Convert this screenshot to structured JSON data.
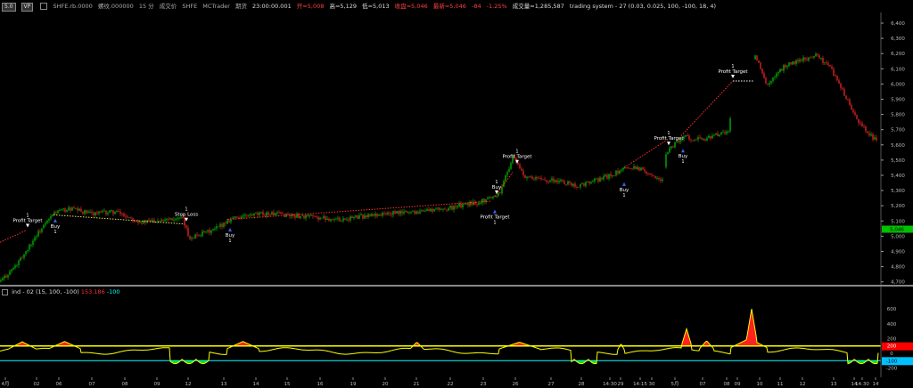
{
  "infobar": {
    "btn1": "5.0",
    "btn2": "VP",
    "symbol": "SHFE.rb.0000",
    "name": "螺纹.000000",
    "interval": "15 分",
    "label_chengjiao": "成交价",
    "exchange": "SHFE",
    "platform": "MCTrader",
    "label_futures": "期货",
    "time": "23:00:00.001",
    "open": "开=5,008",
    "high": "高=5,129",
    "low": "低=5,013",
    "close": "收盘=5,046",
    "close_label": "最新=5,046",
    "change": "-84",
    "change_pct": "-1.25%",
    "volume": "成交量=1,285,587",
    "strategy": "trading system - 27 (0.03, 0.025, 100, -100, 18, 4)"
  },
  "price_axis": {
    "ticks": [
      "6,400",
      "6,300",
      "6,200",
      "6,100",
      "6,000",
      "5,900",
      "5,800",
      "5,700",
      "5,600",
      "5,500",
      "5,400",
      "5,300",
      "5,200",
      "5,100",
      "5,000",
      "4,900",
      "4,800",
      "4,700"
    ],
    "last_price": "5,046"
  },
  "trade_labels": [
    {
      "text": "Profit Target",
      "n": "1"
    },
    {
      "text": "Buy",
      "n": "1"
    },
    {
      "text": "Stop Loss",
      "n": "1"
    },
    {
      "text": "Buy",
      "n": "1"
    },
    {
      "text": "Profit Target",
      "n": "1"
    },
    {
      "text": "Buy",
      "n": "1"
    },
    {
      "text": "Profit Target",
      "n": "1"
    },
    {
      "text": "Buy",
      "n": "1"
    },
    {
      "text": "Profit Target",
      "n": "1"
    },
    {
      "text": "Buy",
      "n": "1"
    },
    {
      "text": "Profit Target",
      "n": "1"
    }
  ],
  "indicator": {
    "name": "ind - 02",
    "params": "(15, 100, -100)",
    "v1": "153.186",
    "v2": "-100",
    "ticks": [
      "600",
      "400",
      "200",
      "0",
      "-200"
    ],
    "badge_upper": "200",
    "badge_lower": "-100",
    "colors": {
      "upper": "#ffff00",
      "lower": "#00ffff",
      "hist_pos": "#ff2020",
      "line": "#ffff00",
      "neg": "#00e000"
    }
  },
  "time_axis": {
    "labels": [
      "4月",
      "02",
      "06",
      "07",
      "08",
      "09",
      "12",
      "13",
      "14",
      "15",
      "16",
      "19",
      "20",
      "21",
      "22",
      "23",
      "26",
      "27",
      "28",
      "14:30",
      "29",
      "14:15",
      "30",
      "5月",
      "07",
      "08",
      "09",
      "10",
      "11",
      "12",
      "13",
      "14",
      "14:30",
      "14"
    ]
  },
  "colors": {
    "up": "#00d000",
    "down": "#ff2a2a",
    "trend": "#ff3030",
    "stop": "#e0e060"
  }
}
